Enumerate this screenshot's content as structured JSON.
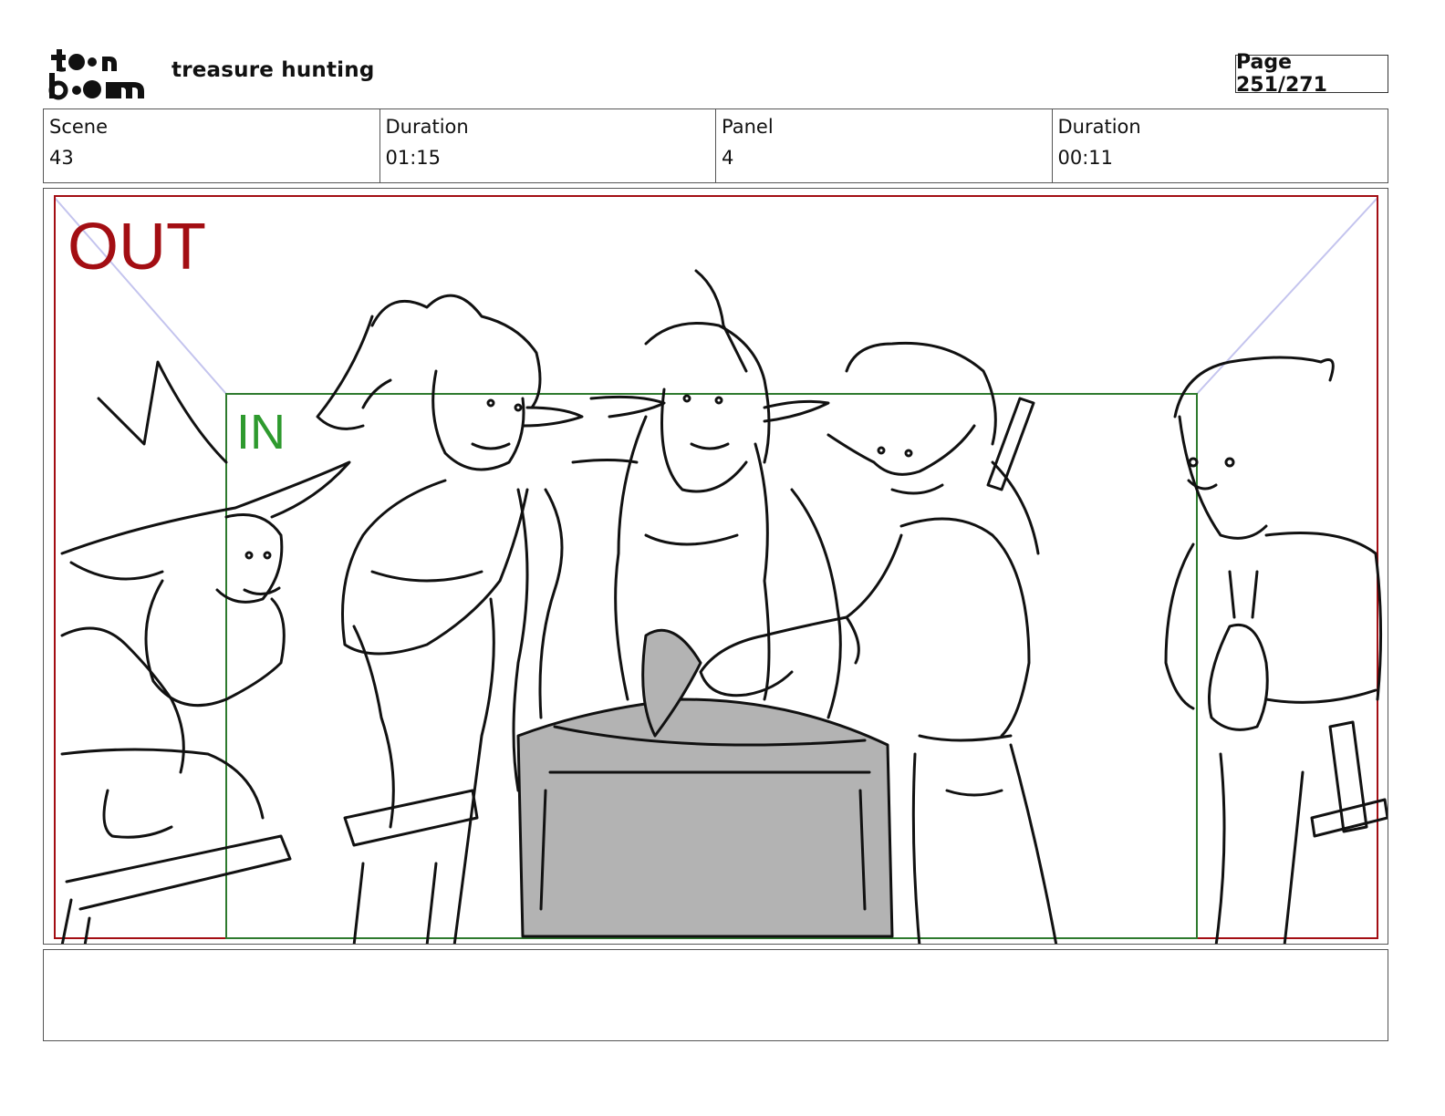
{
  "header": {
    "logo_text": "toonboom",
    "project_title": "treasure hunting",
    "page_label": "Page 251/271"
  },
  "info": {
    "scene_label": "Scene",
    "scene_value": "43",
    "scene_duration_label": "Duration",
    "scene_duration_value": "01:15",
    "panel_label": "Panel",
    "panel_value": "4",
    "panel_duration_label": "Duration",
    "panel_duration_value": "00:11"
  },
  "panel": {
    "out_label": "OUT",
    "in_label": "IN",
    "out_color": "#a30e13",
    "in_color": "#2e9a2e",
    "guide_color": "#b8b8e8"
  },
  "notes": {
    "text": ""
  }
}
